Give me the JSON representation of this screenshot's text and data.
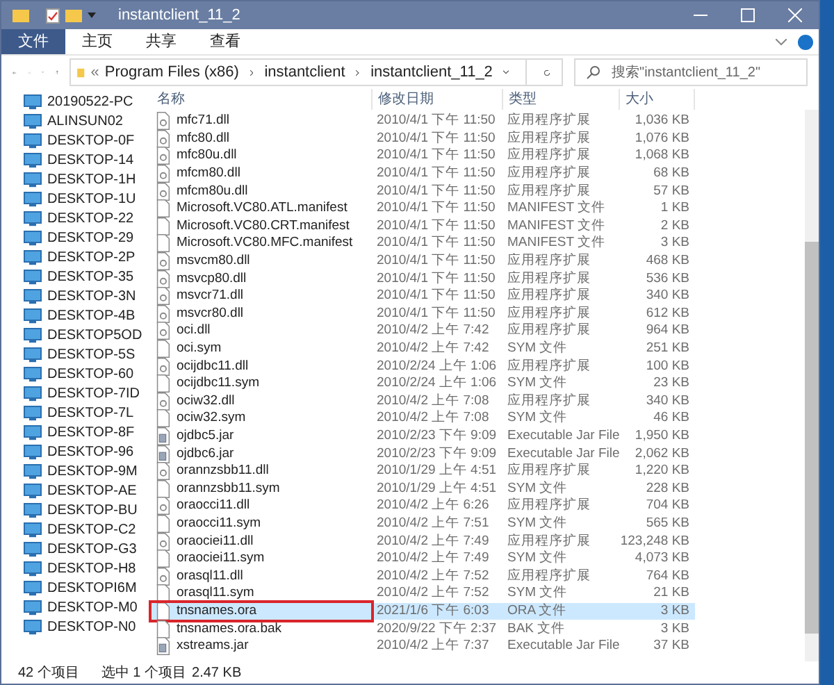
{
  "window": {
    "title": "instantclient_11_2"
  },
  "ribbon_tabs": [
    {
      "label": "文件",
      "selected": true
    },
    {
      "label": "主页",
      "selected": false
    },
    {
      "label": "共享",
      "selected": false
    },
    {
      "label": "查看",
      "selected": false
    }
  ],
  "address": {
    "prefix": "«",
    "crumbs": [
      "Program Files (x86)",
      "instantclient",
      "instantclient_11_2"
    ]
  },
  "search": {
    "placeholder": "搜索\"instantclient_11_2\""
  },
  "sidebar": {
    "items": [
      "20190522-PC",
      "ALINSUN02",
      "DESKTOP-0F",
      "DESKTOP-14",
      "DESKTOP-1H",
      "DESKTOP-1U",
      "DESKTOP-22",
      "DESKTOP-29",
      "DESKTOP-2P",
      "DESKTOP-35",
      "DESKTOP-3N",
      "DESKTOP-4B",
      "DESKTOP5OD",
      "DESKTOP-5S",
      "DESKTOP-60",
      "DESKTOP-7ID",
      "DESKTOP-7L",
      "DESKTOP-8F",
      "DESKTOP-96",
      "DESKTOP-9M",
      "DESKTOP-AE",
      "DESKTOP-BU",
      "DESKTOP-C2",
      "DESKTOP-G3",
      "DESKTOP-H8",
      "DESKTOPI6M",
      "DESKTOP-M0",
      "DESKTOP-N0"
    ]
  },
  "table": {
    "columns": [
      "名称",
      "修改日期",
      "类型",
      "大小"
    ],
    "rows": [
      {
        "kind": "dll",
        "name": "mfc71.dll",
        "date": "2010/4/1 下午 11:50",
        "type": "应用程序扩展",
        "size": "1,036 KB",
        "selected": false,
        "highlighted": false
      },
      {
        "kind": "dll",
        "name": "mfc80.dll",
        "date": "2010/4/1 下午 11:50",
        "type": "应用程序扩展",
        "size": "1,076 KB",
        "selected": false,
        "highlighted": false
      },
      {
        "kind": "dll",
        "name": "mfc80u.dll",
        "date": "2010/4/1 下午 11:50",
        "type": "应用程序扩展",
        "size": "1,068 KB",
        "selected": false,
        "highlighted": false
      },
      {
        "kind": "dll",
        "name": "mfcm80.dll",
        "date": "2010/4/1 下午 11:50",
        "type": "应用程序扩展",
        "size": "68 KB",
        "selected": false,
        "highlighted": false
      },
      {
        "kind": "dll",
        "name": "mfcm80u.dll",
        "date": "2010/4/1 下午 11:50",
        "type": "应用程序扩展",
        "size": "57 KB",
        "selected": false,
        "highlighted": false
      },
      {
        "kind": "file",
        "name": "Microsoft.VC80.ATL.manifest",
        "date": "2010/4/1 下午 11:50",
        "type": "MANIFEST 文件",
        "size": "1 KB",
        "selected": false,
        "highlighted": false
      },
      {
        "kind": "file",
        "name": "Microsoft.VC80.CRT.manifest",
        "date": "2010/4/1 下午 11:50",
        "type": "MANIFEST 文件",
        "size": "2 KB",
        "selected": false,
        "highlighted": false
      },
      {
        "kind": "file",
        "name": "Microsoft.VC80.MFC.manifest",
        "date": "2010/4/1 下午 11:50",
        "type": "MANIFEST 文件",
        "size": "3 KB",
        "selected": false,
        "highlighted": false
      },
      {
        "kind": "dll",
        "name": "msvcm80.dll",
        "date": "2010/4/1 下午 11:50",
        "type": "应用程序扩展",
        "size": "468 KB",
        "selected": false,
        "highlighted": false
      },
      {
        "kind": "dll",
        "name": "msvcp80.dll",
        "date": "2010/4/1 下午 11:50",
        "type": "应用程序扩展",
        "size": "536 KB",
        "selected": false,
        "highlighted": false
      },
      {
        "kind": "dll",
        "name": "msvcr71.dll",
        "date": "2010/4/1 下午 11:50",
        "type": "应用程序扩展",
        "size": "340 KB",
        "selected": false,
        "highlighted": false
      },
      {
        "kind": "dll",
        "name": "msvcr80.dll",
        "date": "2010/4/1 下午 11:50",
        "type": "应用程序扩展",
        "size": "612 KB",
        "selected": false,
        "highlighted": false
      },
      {
        "kind": "dll",
        "name": "oci.dll",
        "date": "2010/4/2 上午 7:42",
        "type": "应用程序扩展",
        "size": "964 KB",
        "selected": false,
        "highlighted": false
      },
      {
        "kind": "file",
        "name": "oci.sym",
        "date": "2010/4/2 上午 7:42",
        "type": "SYM 文件",
        "size": "251 KB",
        "selected": false,
        "highlighted": false
      },
      {
        "kind": "dll",
        "name": "ocijdbc11.dll",
        "date": "2010/2/24 上午 1:06",
        "type": "应用程序扩展",
        "size": "100 KB",
        "selected": false,
        "highlighted": false
      },
      {
        "kind": "file",
        "name": "ocijdbc11.sym",
        "date": "2010/2/24 上午 1:06",
        "type": "SYM 文件",
        "size": "23 KB",
        "selected": false,
        "highlighted": false
      },
      {
        "kind": "dll",
        "name": "ociw32.dll",
        "date": "2010/4/2 上午 7:08",
        "type": "应用程序扩展",
        "size": "340 KB",
        "selected": false,
        "highlighted": false
      },
      {
        "kind": "file",
        "name": "ociw32.sym",
        "date": "2010/4/2 上午 7:08",
        "type": "SYM 文件",
        "size": "46 KB",
        "selected": false,
        "highlighted": false
      },
      {
        "kind": "jar",
        "name": "ojdbc5.jar",
        "date": "2010/2/23 下午 9:09",
        "type": "Executable Jar File",
        "size": "1,950 KB",
        "selected": false,
        "highlighted": false
      },
      {
        "kind": "jar",
        "name": "ojdbc6.jar",
        "date": "2010/2/23 下午 9:09",
        "type": "Executable Jar File",
        "size": "2,062 KB",
        "selected": false,
        "highlighted": false
      },
      {
        "kind": "dll",
        "name": "orannzsbb11.dll",
        "date": "2010/1/29 上午 4:51",
        "type": "应用程序扩展",
        "size": "1,220 KB",
        "selected": false,
        "highlighted": false
      },
      {
        "kind": "file",
        "name": "orannzsbb11.sym",
        "date": "2010/1/29 上午 4:51",
        "type": "SYM 文件",
        "size": "228 KB",
        "selected": false,
        "highlighted": false
      },
      {
        "kind": "dll",
        "name": "oraocci11.dll",
        "date": "2010/4/2 上午 6:26",
        "type": "应用程序扩展",
        "size": "704 KB",
        "selected": false,
        "highlighted": false
      },
      {
        "kind": "file",
        "name": "oraocci11.sym",
        "date": "2010/4/2 上午 7:51",
        "type": "SYM 文件",
        "size": "565 KB",
        "selected": false,
        "highlighted": false
      },
      {
        "kind": "dll",
        "name": "oraociei11.dll",
        "date": "2010/4/2 上午 7:49",
        "type": "应用程序扩展",
        "size": "123,248 KB",
        "selected": false,
        "highlighted": false
      },
      {
        "kind": "file",
        "name": "oraociei11.sym",
        "date": "2010/4/2 上午 7:49",
        "type": "SYM 文件",
        "size": "4,073 KB",
        "selected": false,
        "highlighted": false
      },
      {
        "kind": "dll",
        "name": "orasql11.dll",
        "date": "2010/4/2 上午 7:52",
        "type": "应用程序扩展",
        "size": "764 KB",
        "selected": false,
        "highlighted": false
      },
      {
        "kind": "file",
        "name": "orasql11.sym",
        "date": "2010/4/2 上午 7:52",
        "type": "SYM 文件",
        "size": "21 KB",
        "selected": false,
        "highlighted": false
      },
      {
        "kind": "file",
        "name": "tnsnames.ora",
        "date": "2021/1/6 下午 6:03",
        "type": "ORA 文件",
        "size": "3 KB",
        "selected": true,
        "highlighted": true
      },
      {
        "kind": "file",
        "name": "tnsnames.ora.bak",
        "date": "2020/9/22 下午 2:37",
        "type": "BAK 文件",
        "size": "3 KB",
        "selected": false,
        "highlighted": false
      },
      {
        "kind": "jar",
        "name": "xstreams.jar",
        "date": "2010/4/2 上午 7:37",
        "type": "Executable Jar File",
        "size": "37 KB",
        "selected": false,
        "highlighted": false
      }
    ]
  },
  "status_bar": {
    "count": "42 个项目",
    "selection": "选中 1 个项目",
    "size": "2.47 KB"
  }
}
